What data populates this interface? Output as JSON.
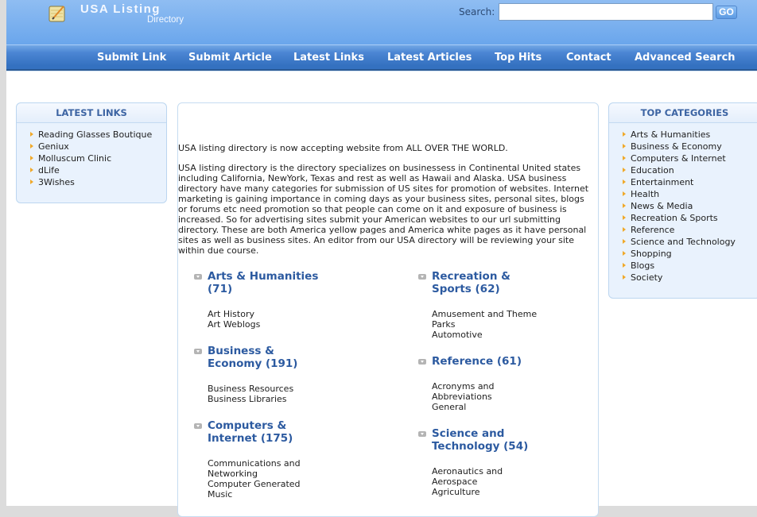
{
  "header": {
    "logo_title": "USA Listing",
    "logo_subtitle": "Directory",
    "search_label": "Search:",
    "search_value": "",
    "go_label": "GO"
  },
  "nav": {
    "items": [
      {
        "label": "Submit Link"
      },
      {
        "label": "Submit Article"
      },
      {
        "label": "Latest Links"
      },
      {
        "label": "Latest Articles"
      },
      {
        "label": "Top Hits"
      },
      {
        "label": "Contact"
      },
      {
        "label": "Advanced Search"
      }
    ]
  },
  "latest_links": {
    "title": "LATEST LINKS",
    "items": [
      "Reading Glasses Boutique",
      "Geniux",
      "Molluscum Clinic",
      "dLife",
      "3Wishes"
    ]
  },
  "top_categories": {
    "title": "TOP CATEGORIES",
    "items": [
      "Arts & Humanities",
      "Business & Economy",
      "Computers & Internet",
      "Education",
      "Entertainment",
      "Health",
      "News & Media",
      "Recreation & Sports",
      "Reference",
      "Science and Technology",
      "Shopping",
      "Blogs",
      "Society"
    ]
  },
  "main": {
    "intro_short": "USA listing directory is now accepting website from ALL OVER THE WORLD.",
    "intro_long": "USA listing directory is the directory specializes on businessess in Continental United states including California, NewYork, Texas and rest as well as Hawaii and Alaska. USA business directory have many categories for submission of US sites for promotion of websites. Internet marketing is gaining importance in coming days as your business sites, personal sites, blogs or forums etc need promotion so that people can come on it and exposure of business is increased. So for advertising sites submit your American websites to our url submitting directory. These are both America yellow pages and America white pages as it have personal sites as well as business sites. An editor from our USA directory will be reviewing your site within due course.",
    "categories": [
      {
        "title": "Arts & Humanities (71)",
        "subs": [
          "Art History",
          "Art Weblogs"
        ]
      },
      {
        "title": "Business & Economy (191)",
        "subs": [
          "Business Resources",
          "Business Libraries"
        ]
      },
      {
        "title": "Computers & Internet (175)",
        "subs": [
          "Communications and Networking",
          "Computer Generated Music"
        ]
      },
      {
        "title": "Recreation & Sports (62)",
        "subs": [
          "Amusement and Theme Parks",
          "Automotive"
        ]
      },
      {
        "title": "Reference (61)",
        "subs": [
          "Acronyms and Abbreviations",
          "General"
        ]
      },
      {
        "title": "Science and Technology (54)",
        "subs": [
          "Aeronautics and Aerospace",
          "Agriculture"
        ]
      }
    ]
  }
}
